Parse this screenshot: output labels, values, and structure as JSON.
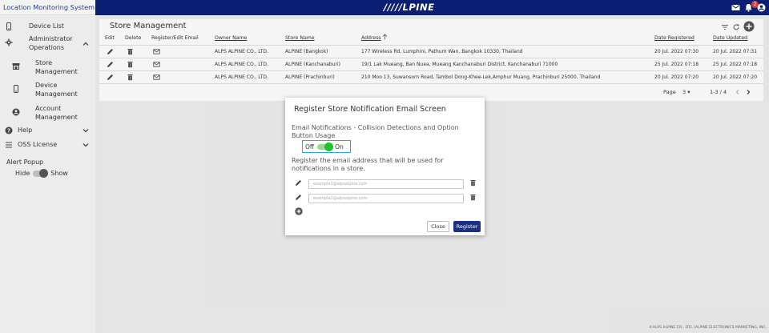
{
  "app": {
    "title": "Location Monitoring System",
    "logo": "/////LPINE",
    "notification_count": "2"
  },
  "sidebar": {
    "device_list": "Device List",
    "admin_ops": "Administrator Operations",
    "store_mgmt": "Store Management",
    "device_mgmt": "Device Management",
    "account_mgmt": "Account Management",
    "help": "Help",
    "oss": "OSS License",
    "alert_popup": "Alert Popup",
    "hide": "Hide",
    "show": "Show"
  },
  "main": {
    "title": "Store Management",
    "headers": {
      "edit": "Edit",
      "delete": "Delete",
      "register": "Register/Edit Email",
      "owner": "Owner Name",
      "store": "Store Name",
      "address": "Address",
      "registered": "Date Registered",
      "updated": "Date Updated"
    },
    "rows": [
      {
        "owner": "ALPS ALPINE CO., LTD.",
        "store": "ALPINE (Bangkok)",
        "address": "177 Wireless Rd, Lumphini, Pathum Wan, Bangkok 10330, Thailand",
        "registered": "20 Jul. 2022 07:30",
        "updated": "20 Jul. 2022 07:31"
      },
      {
        "owner": "ALPS ALPINE CO., LTD.",
        "store": "ALPINE (Kanchanaburi)",
        "address": "19/1 Lak Mueang, Ban Nuea, Mueang Kanchanaburi District, Kanchanaburi 71000",
        "registered": "25 Jul. 2022 07:18",
        "updated": "25 Jul. 2022 07:18"
      },
      {
        "owner": "ALPS ALPINE CO., LTD.",
        "store": "ALPINE (Prachinburi)",
        "address": "210 Moo 13, Suwansorn Road, Tambol Dong-Khee-Lek,Amphur Muang, Prachinburi 25000, Thailand",
        "registered": "20 Jul. 2022 07:20",
        "updated": "20 Jul. 2022 07:20"
      }
    ],
    "pager": {
      "page_label": "Page",
      "page_value": "3",
      "range": "1-3 / 4"
    }
  },
  "footer": "©ALPS ALPINE CO., LTD. /ALPINE ELECTRONICS MARKETING, INC.",
  "dialog": {
    "title": "Register Store Notification Email Screen",
    "subtitle": "Email Notifications - Collision Detections and Option Button Usage",
    "toggle_off": "Off",
    "toggle_on": "On",
    "description": "Register the email address that will be used for notifications in a store.",
    "email1_placeholder": "example1@alpsalpine.com",
    "email2_placeholder": "example2@alpsalpine.com",
    "close_label": "Close",
    "register_label": "Register"
  },
  "colors": {
    "header": "#0a1f73",
    "accent": "#1f3f95",
    "toggle_on": "#22c12b",
    "highlight": "#2aa7df"
  }
}
